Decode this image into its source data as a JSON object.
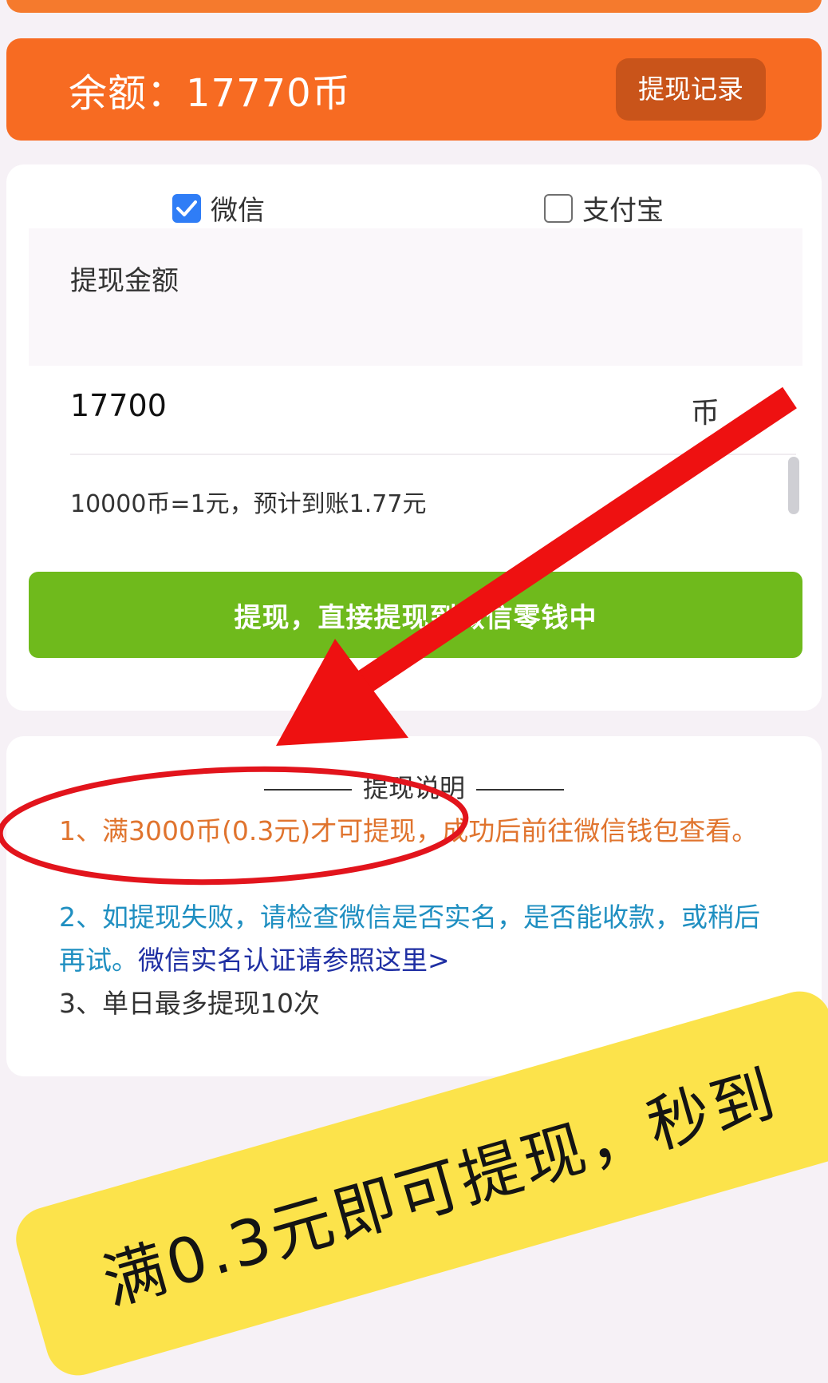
{
  "balance": {
    "text": "余额：17770币",
    "record_button": "提现记录"
  },
  "payment_methods": [
    {
      "label": "微信",
      "checked": true
    },
    {
      "label": "支付宝",
      "checked": false
    }
  ],
  "form": {
    "amount_label": "提现金额",
    "amount_value": "17700",
    "amount_unit": "币",
    "rate_info": "10000币=1元，预计到账1.77元",
    "submit_label": "提现，直接提现到微信零钱中"
  },
  "notes": {
    "title": "提现说明",
    "items": [
      "1、满3000币(0.3元)才可提现，成功后前往微信钱包查看。",
      "2、如提现失败，请检查微信是否实名，是否能收款，或稍后再试。",
      "3、单日最多提现10次"
    ],
    "link_text": "微信实名认证请参照这里>"
  },
  "banner": {
    "text": "满0.3元即可提现，秒到"
  },
  "colors": {
    "header_orange": "#f76b22",
    "record_button": "#c9541a",
    "submit_green": "#6fba1c",
    "checkbox_blue": "#2f7df6",
    "note_orange": "#e0742e",
    "note_blue": "#1f8fc1",
    "link_blue": "#1f2fa3",
    "annotation_red": "#ee1111",
    "banner_yellow": "#fce34b"
  }
}
